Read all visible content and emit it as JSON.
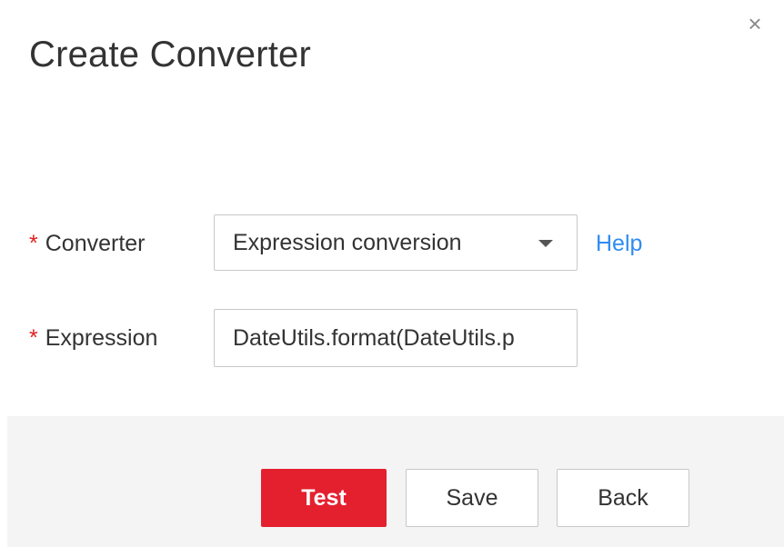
{
  "dialog": {
    "title": "Create Converter",
    "close_symbol": "×"
  },
  "form": {
    "converter": {
      "required_mark": "*",
      "label": "Converter",
      "selected_value": "Expression conversion",
      "help_link": "Help"
    },
    "expression": {
      "required_mark": "*",
      "label": "Expression",
      "value": "DateUtils.format(DateUtils.p"
    }
  },
  "footer": {
    "test_label": "Test",
    "save_label": "Save",
    "back_label": "Back"
  },
  "colors": {
    "primary_button": "#e4202f",
    "link": "#2f8cf0",
    "required": "#e02020",
    "footer_bg": "#f4f4f4"
  },
  "icons": {
    "close": "close-icon",
    "dropdown": "chevron-down-icon"
  }
}
